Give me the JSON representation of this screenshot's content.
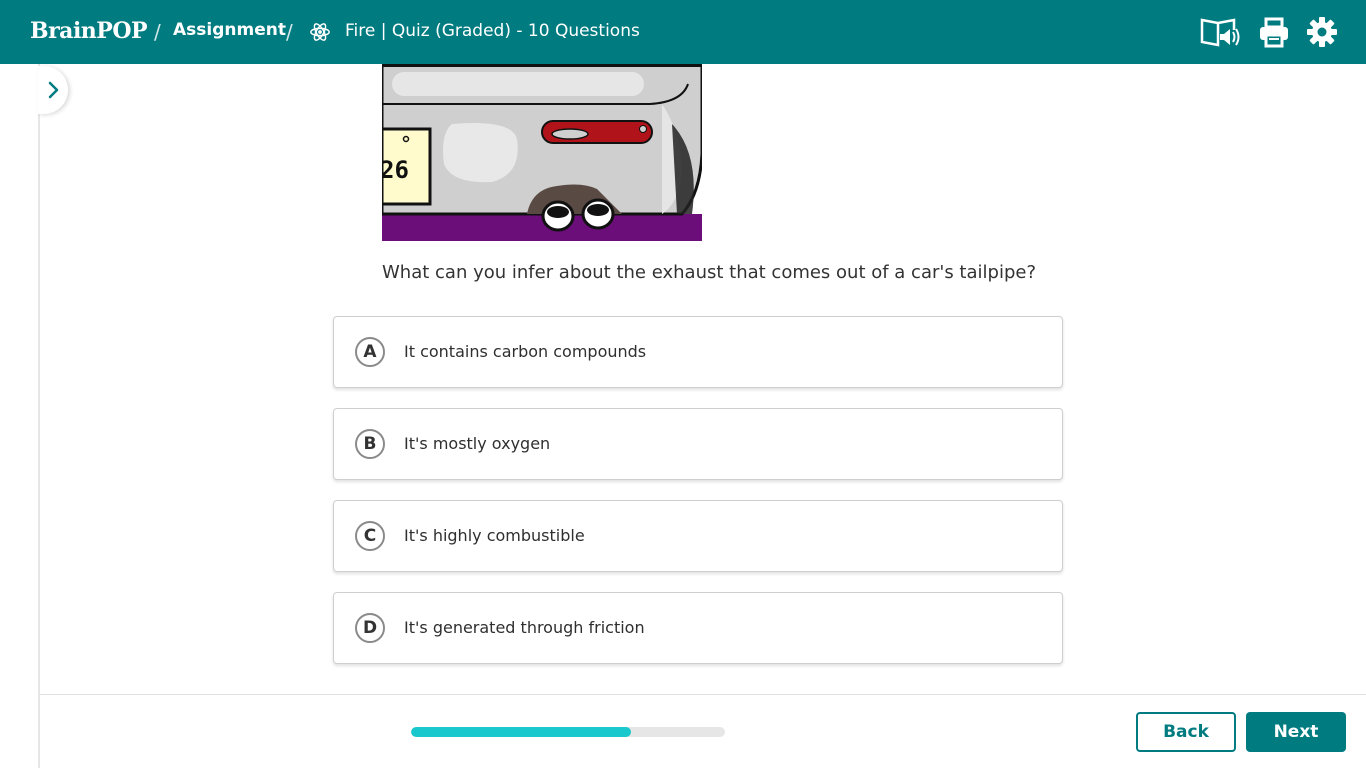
{
  "header": {
    "logo": "BrainPOP",
    "breadcrumb_sep": "/",
    "assignment": "Assignment",
    "quiz_title": "Fire | Quiz (Graded) - 10 Questions",
    "icons": [
      "read-aloud-icon",
      "print-icon",
      "gear-icon"
    ],
    "bg_color": "#007b80"
  },
  "question": {
    "image_plate_text": "26",
    "text": "What can you infer about the exhaust that comes out of a car's tailpipe?"
  },
  "answers": [
    {
      "letter": "A",
      "text": "It contains carbon compounds"
    },
    {
      "letter": "B",
      "text": "It's mostly oxygen"
    },
    {
      "letter": "C",
      "text": "It's highly combustible"
    },
    {
      "letter": "D",
      "text": "It's generated through friction"
    }
  ],
  "footer": {
    "progress": 0.7,
    "back_label": "Back",
    "next_label": "Next",
    "accent_color": "#18c8cc"
  }
}
